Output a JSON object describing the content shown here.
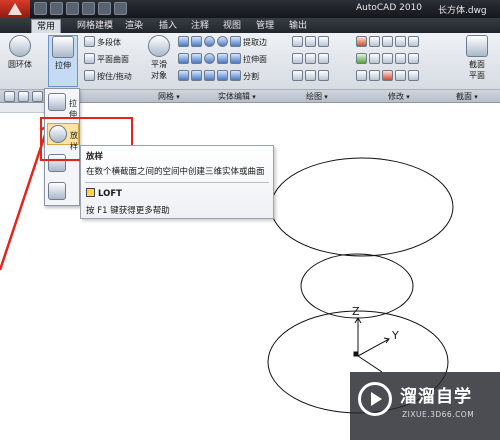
{
  "titlebar": {
    "app_title": "AutoCAD 2010",
    "file_name": "长方体.dwg"
  },
  "tabs": [
    "常用",
    "网格建模",
    "渲染",
    "插入",
    "注释",
    "视图",
    "管理",
    "输出"
  ],
  "ribbon": {
    "big_buttons": {
      "torus": "圆环体",
      "extrude": "拉伸",
      "smooth": "平滑",
      "smooth2": "对象",
      "section": "截面",
      "section2": "平面"
    },
    "small_buttons": {
      "polysolid": "多段体",
      "planar": "平面曲面",
      "presspull": "按住/拖动",
      "extract": "提取边",
      "extrude_face": "拉伸面",
      "separate": "分割"
    },
    "panels": [
      "网格",
      "实体编辑",
      "绘图",
      "修改",
      "截面"
    ]
  },
  "dropdown": {
    "items": [
      "拉伸",
      "放样"
    ]
  },
  "tooltip": {
    "title": "放样",
    "description": "在数个横截面之间的空间中创建三维实体或曲面",
    "command": "LOFT",
    "help": "按 F1 键获得更多帮助"
  },
  "canvas": {
    "axis_z": "Z",
    "axis_y": "Y"
  },
  "watermark": {
    "brand": "溜溜自学",
    "url": "ZIXUE.3D66.COM"
  },
  "colors": {
    "highlight_red": "#e1261c",
    "canvas_bg": "#ffffff",
    "titlebar_bg": "#1b1e24"
  }
}
